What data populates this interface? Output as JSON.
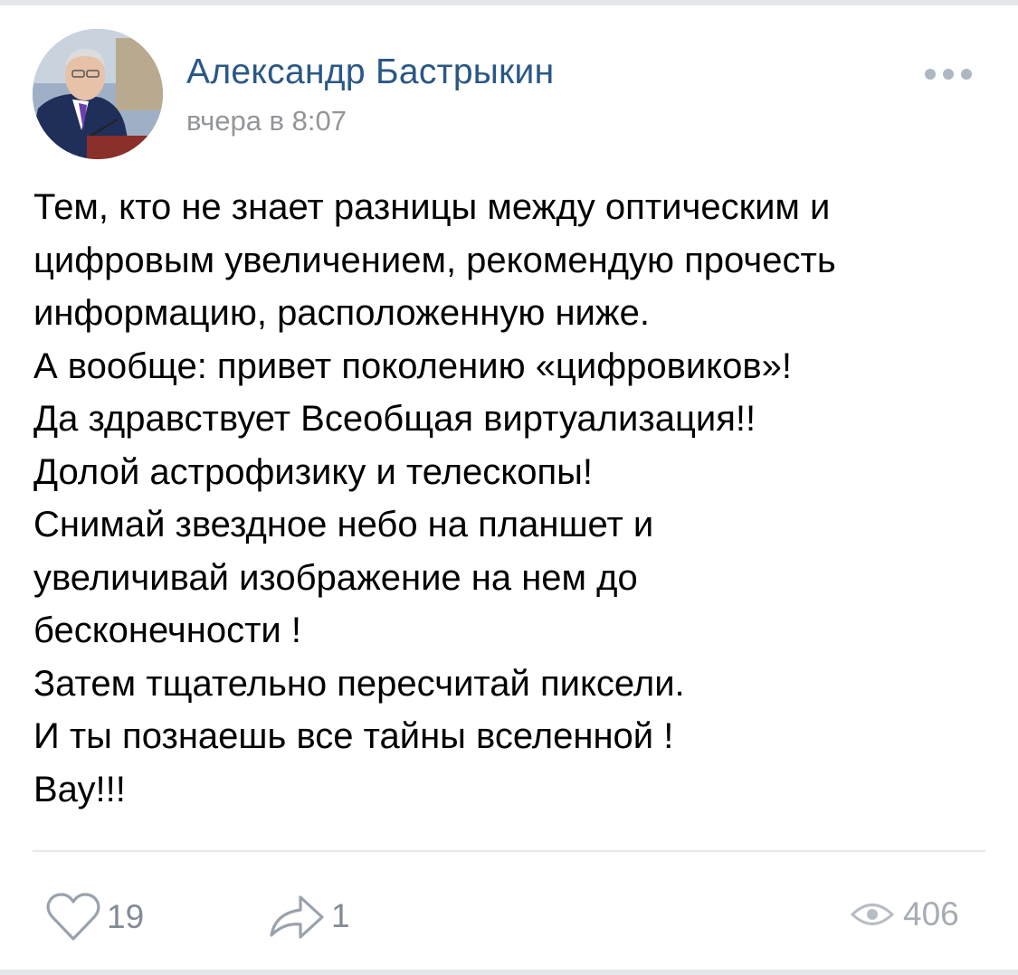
{
  "post": {
    "author": "Александр Бастрыкин",
    "time": "вчера в 8:07",
    "text_lines": [
      "Тем, кто не знает разницы между оптическим и",
      "цифровым увеличением, рекомендую прочесть",
      "информацию, расположенную ниже.",
      "А вообще: привет поколению «цифровиков»!",
      "Да здравствует Всеобщая виртуализация!!",
      "Долой астрофизику и телескопы!",
      "Снимай звездное небо на планшет и",
      "увеличивай изображение на нем до",
      "бесконечности !",
      "Затем тщательно пересчитай пиксели.",
      "И ты познаешь все тайны вселенной !",
      "Вау!!!"
    ]
  },
  "footer": {
    "likes": "19",
    "shares": "1",
    "views": "406"
  },
  "icons": {
    "more": "more-dots-icon",
    "like": "heart-outline-icon",
    "share": "share-arrow-icon",
    "views": "eye-icon"
  },
  "colors": {
    "author": "#2a5885",
    "meta": "#939699",
    "icon": "#99a2ad",
    "divider": "#e7e8ec"
  }
}
